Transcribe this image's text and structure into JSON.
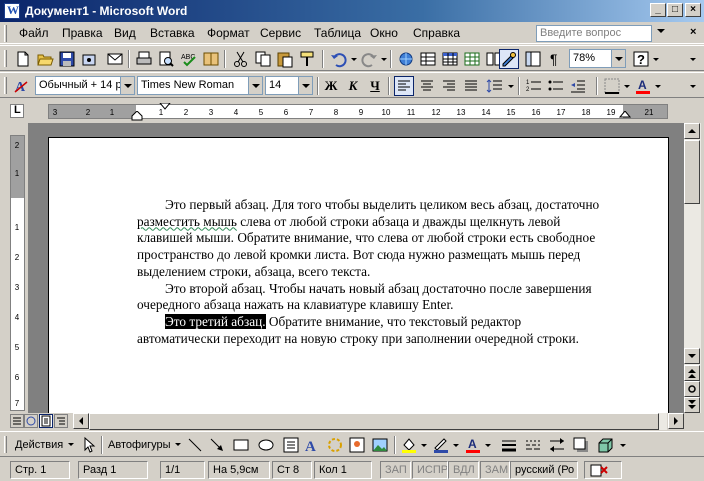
{
  "window": {
    "title": "Документ1 - Microsoft Word"
  },
  "menu": {
    "items": [
      "Файл",
      "Правка",
      "Вид",
      "Вставка",
      "Формат",
      "Сервис",
      "Таблица",
      "Окно",
      "Справка"
    ],
    "ask_placeholder": "Введите вопрос"
  },
  "standard_toolbar": {
    "zoom": "78%"
  },
  "format_toolbar": {
    "style": "Обычный + 14 р",
    "font": "Times New Roman",
    "size": "14",
    "bold": "Ж",
    "italic": "К",
    "underline": "Ч"
  },
  "document": {
    "p1_a": "Это первый абзац. Для того чтобы выделить целиком весь абзац, достаточно ",
    "p1_squiggle": "разместить мышь",
    "p1_b": " слева от любой строки абзаца и дважды щелкнуть левой клавишей мыши. Обратите внимание, что слева от любой строки есть свободное пространство до левой кромки листа. Вот сюда нужно размещать мышь перед выделением строки, абзаца, всего текста.",
    "p2": "Это второй абзац. Чтобы начать новый абзац достаточно после завершения очередного абзаца нажать на клавиатуре клавишу Enter.",
    "p3_selected": "Это третий абзац.",
    "p3_rest": " Обратите внимание, что текстовый редактор автоматически переходит на новую строку при заполнении очередной строки."
  },
  "draw_toolbar": {
    "actions": "Действия",
    "autoshapes": "Автофигуры"
  },
  "status": {
    "page": "Стр. 1",
    "section": "Разд 1",
    "pages": "1/1",
    "at": "На 5,9см",
    "line": "Ст 8",
    "col": "Кол 1",
    "rec": "ЗАП",
    "trk": "ИСПР",
    "ext": "ВДЛ",
    "ovr": "ЗАМ",
    "lang": "русский (Ро"
  },
  "colors": {
    "title_start": "#0a246a",
    "title_end": "#a6caf0",
    "font_color": "#ff0000",
    "highlight": "#ffff00"
  }
}
